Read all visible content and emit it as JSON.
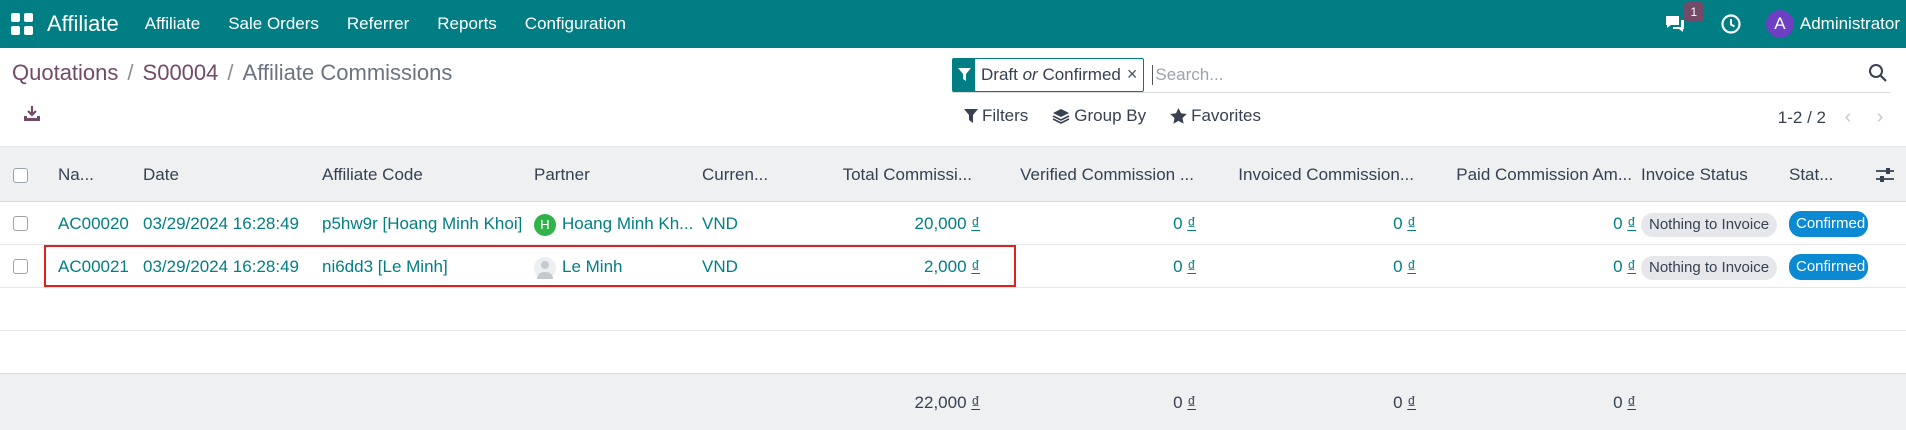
{
  "navbar": {
    "app_title": "Affiliate",
    "menu": [
      "Affiliate",
      "Sale Orders",
      "Referrer",
      "Reports",
      "Configuration"
    ],
    "chat_badge": "1",
    "user_initial": "A",
    "user_name": "Administrator",
    "accent_color": "#017e84"
  },
  "breadcrumb": {
    "items": [
      "Quotations",
      "S00004"
    ],
    "current": "Affiliate Commissions",
    "separator": "/"
  },
  "search": {
    "facet_value_1": "Draft",
    "facet_or": "or",
    "facet_value_2": "Confirmed",
    "facet_close": "×",
    "placeholder": "Search..."
  },
  "filters": {
    "filters_label": "Filters",
    "group_by_label": "Group By",
    "favorites_label": "Favorites"
  },
  "pager": {
    "value": "1-2 / 2",
    "prev": "‹",
    "next": "›"
  },
  "table": {
    "headers": [
      "Na...",
      "Date",
      "Affiliate Code",
      "Partner",
      "Curren...",
      "Total Commissi...",
      "Verified Commission ...",
      "Invoiced Commission...",
      "Paid Commission Am...",
      "Invoice Status",
      "Stat..."
    ],
    "rows": [
      {
        "name": "AC00020",
        "date": "03/29/2024 16:28:49",
        "code": "p5hw9r [Hoang Minh Khoi]",
        "partner": "Hoang Minh Kh...",
        "partner_initial": "H",
        "currency": "VND",
        "total": "20,000",
        "verified": "0",
        "invoiced": "0",
        "paid": "0",
        "invoice_status": "Nothing to Invoice",
        "state": "Confirmed"
      },
      {
        "name": "AC00021",
        "date": "03/29/2024 16:28:49",
        "code": "ni6dd3 [Le Minh]",
        "partner": "Le Minh",
        "partner_initial": "",
        "currency": "VND",
        "total": "2,000",
        "verified": "0",
        "invoiced": "0",
        "paid": "0",
        "invoice_status": "Nothing to Invoice",
        "state": "Confirmed"
      }
    ],
    "currency_symbol": "₫",
    "totals": {
      "total": "22,000",
      "verified": "0",
      "invoiced": "0",
      "paid": "0"
    }
  }
}
